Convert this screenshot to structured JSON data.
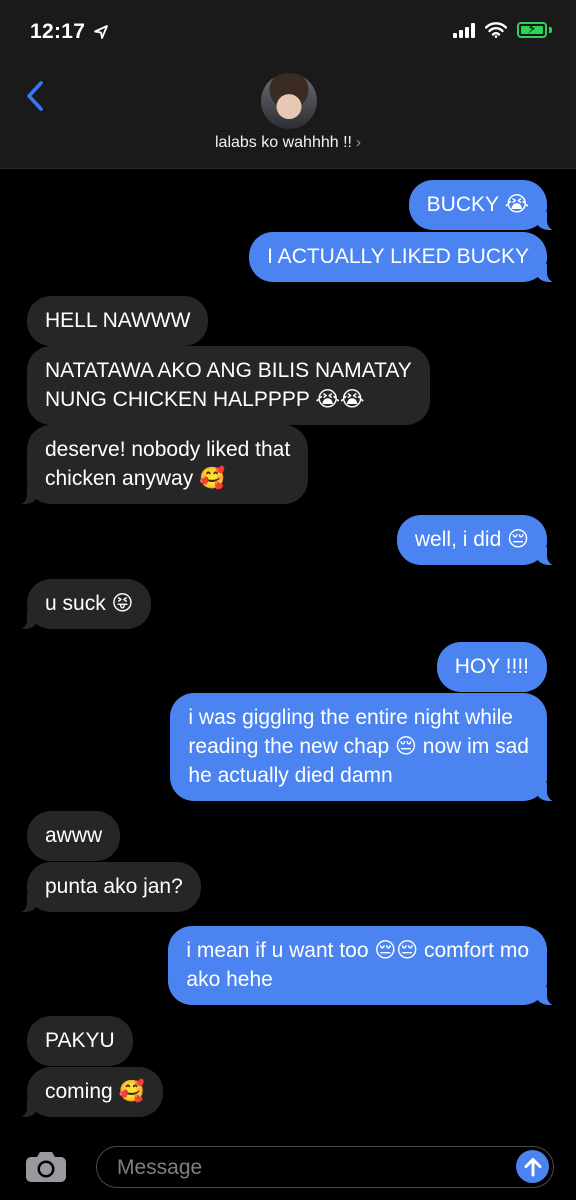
{
  "status_bar": {
    "time": "12:17"
  },
  "header": {
    "contact_name": "lalabs ko wahhhh !!",
    "chevron": "›"
  },
  "messages": [
    {
      "side": "sent",
      "text": "BUCKY 😭"
    },
    {
      "side": "sent",
      "text": "I ACTUALLY LIKED BUCKY"
    },
    {
      "side": "recv",
      "text": "HELL NAWWW"
    },
    {
      "side": "recv",
      "text": "NATATAWA AKO ANG BILIS NAMATAY\nNUNG CHICKEN HALPPPP 😭😭"
    },
    {
      "side": "recv",
      "text": "deserve! nobody liked that\nchicken anyway 🥰"
    },
    {
      "side": "sent",
      "text": "well, i did 😔"
    },
    {
      "side": "recv",
      "text": "u suck 😝"
    },
    {
      "side": "sent",
      "text": "HOY !!!!"
    },
    {
      "side": "sent",
      "text": "i was giggling the entire night while\nreading the new chap 😔 now im sad\nhe actually died damn"
    },
    {
      "side": "recv",
      "text": "awww"
    },
    {
      "side": "recv",
      "text": "punta ako jan?"
    },
    {
      "side": "sent",
      "text": "i mean if u want too 😔😔 comfort mo\nako hehe"
    },
    {
      "side": "recv",
      "text": "PAKYU"
    },
    {
      "side": "recv",
      "text": "coming 🥰"
    }
  ],
  "composer": {
    "placeholder": "Message"
  },
  "colors": {
    "sent_bubble": "#4b84f0",
    "received_bubble": "#262628",
    "accent": "#3478f6",
    "battery": "#30d158"
  }
}
